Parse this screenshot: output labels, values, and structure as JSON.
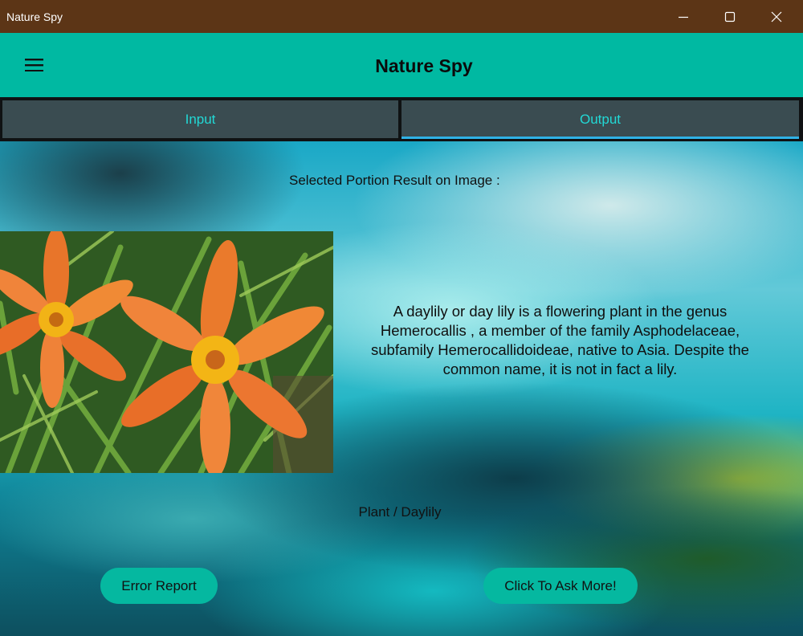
{
  "window": {
    "title": "Nature Spy",
    "controls": [
      "minimize-icon",
      "maximize-icon",
      "close-icon"
    ],
    "titlebar_color": "#5c3516"
  },
  "appbar": {
    "title": "Nature Spy",
    "menu_icon": "hamburger-menu-icon",
    "color": "#00b9a2"
  },
  "tabs": [
    {
      "label": "Input",
      "selected": false
    },
    {
      "label": "Output",
      "selected": true
    }
  ],
  "result": {
    "caption": "Selected Portion Result on Image :",
    "image_alt": "orange-daylily-flowers",
    "description": "A daylily or day lily is a flowering plant in the genus Hemerocallis , a member of the family Asphodelaceae, subfamily Hemerocallidoideae, native to Asia. Despite the common name, it is not in fact a lily.",
    "label": "Plant / Daylily"
  },
  "actions": {
    "error_report": "Error Report",
    "ask_more": "Click To Ask More!",
    "button_color": "#05b8a0"
  }
}
